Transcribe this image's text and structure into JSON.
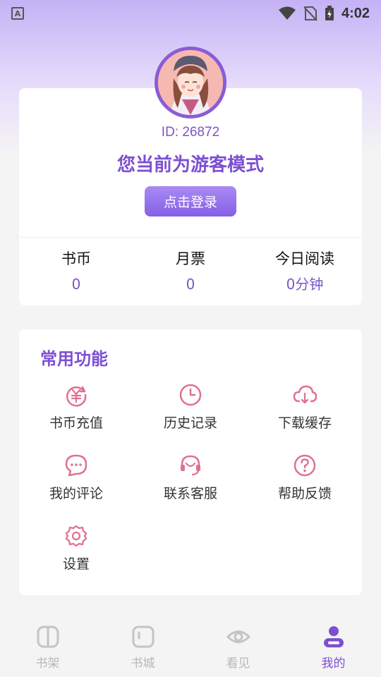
{
  "status_bar": {
    "left_badge": "A",
    "time": "4:02",
    "icons": [
      "wifi-icon",
      "no-sim-icon",
      "battery-charging-icon"
    ]
  },
  "profile": {
    "user_id": "ID: 26872",
    "guest_title": "您当前为游客模式",
    "login_label": "点击登录",
    "stats": [
      {
        "label": "书币",
        "value": "0"
      },
      {
        "label": "月票",
        "value": "0"
      },
      {
        "label": "今日阅读",
        "value": "0分钟"
      }
    ]
  },
  "functions": {
    "title": "常用功能",
    "items": [
      {
        "label": "书币充值",
        "icon": "coin-recharge-icon"
      },
      {
        "label": "历史记录",
        "icon": "clock-icon"
      },
      {
        "label": "下载缓存",
        "icon": "cloud-download-icon"
      },
      {
        "label": "我的评论",
        "icon": "comment-icon"
      },
      {
        "label": "联系客服",
        "icon": "headset-icon"
      },
      {
        "label": "帮助反馈",
        "icon": "help-icon"
      },
      {
        "label": "设置",
        "icon": "settings-gear-icon"
      }
    ]
  },
  "tabs": [
    {
      "label": "书架",
      "icon": "bookshelf-icon",
      "active": false
    },
    {
      "label": "书城",
      "icon": "bookstore-icon",
      "active": false
    },
    {
      "label": "看见",
      "icon": "eye-icon",
      "active": false
    },
    {
      "label": "我的",
      "icon": "user-icon",
      "active": true
    }
  ],
  "colors": {
    "accent": "#7c4fd3",
    "icon_pink": "#e0718e",
    "tab_inactive": "#b8b8b8"
  }
}
